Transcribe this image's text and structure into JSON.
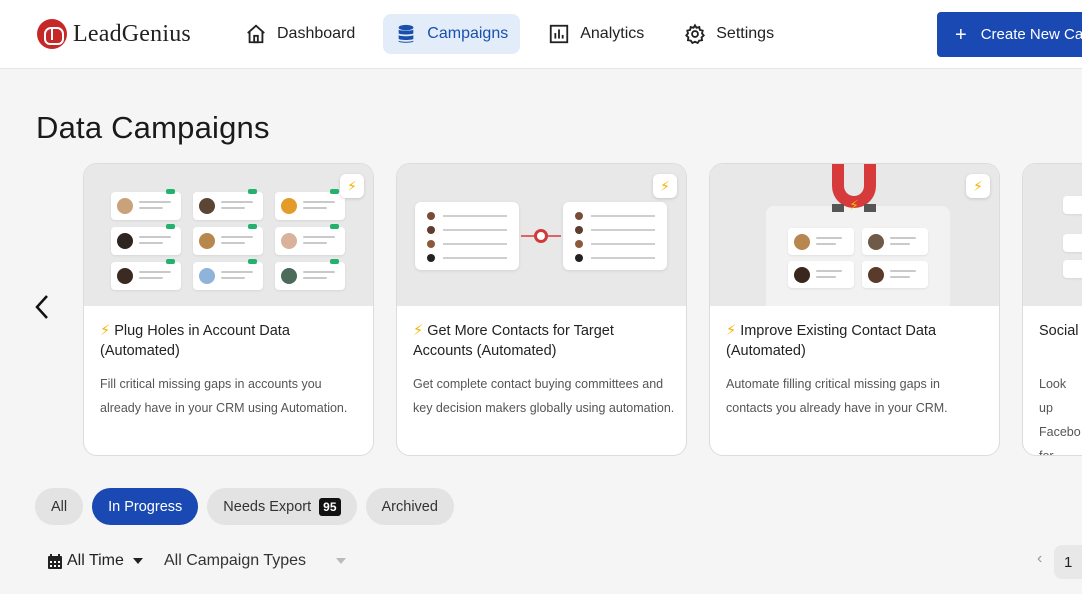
{
  "brand": {
    "name": "LeadGenius",
    "accent": "#1a49b3"
  },
  "nav": {
    "items": [
      {
        "label": "Dashboard",
        "icon": "home-icon",
        "active": false
      },
      {
        "label": "Campaigns",
        "icon": "database-icon",
        "active": true
      },
      {
        "label": "Analytics",
        "icon": "bar-chart-icon",
        "active": false
      },
      {
        "label": "Settings",
        "icon": "gear-icon",
        "active": false
      }
    ],
    "create_button": "Create New Car"
  },
  "page": {
    "title": "Data Campaigns"
  },
  "cards": [
    {
      "bolt": "⚡",
      "title": "Plug Holes in Account Data (Automated)",
      "description": "Fill critical missing gaps in accounts you already have in your CRM using Automation."
    },
    {
      "bolt": "⚡",
      "title": "Get More Contacts for Target Accounts (Automated)",
      "description": "Get complete contact buying committees and key decision makers globally using automation."
    },
    {
      "bolt": "⚡",
      "title": "Improve Existing Contact Data (Automated)",
      "description": "Automate filling critical missing gaps in contacts you already have in your CRM."
    },
    {
      "title": "Social",
      "description": "Look up Facebo for each"
    }
  ],
  "filters": {
    "status_tabs": [
      {
        "label": "All",
        "active": false
      },
      {
        "label": "In Progress",
        "active": true
      },
      {
        "label": "Needs Export",
        "active": false,
        "count": "95"
      },
      {
        "label": "Archived",
        "active": false
      }
    ],
    "time": "All Time",
    "campaign_type": "All Campaign Types"
  },
  "pagination": {
    "prev": "‹",
    "current_page": "1"
  }
}
